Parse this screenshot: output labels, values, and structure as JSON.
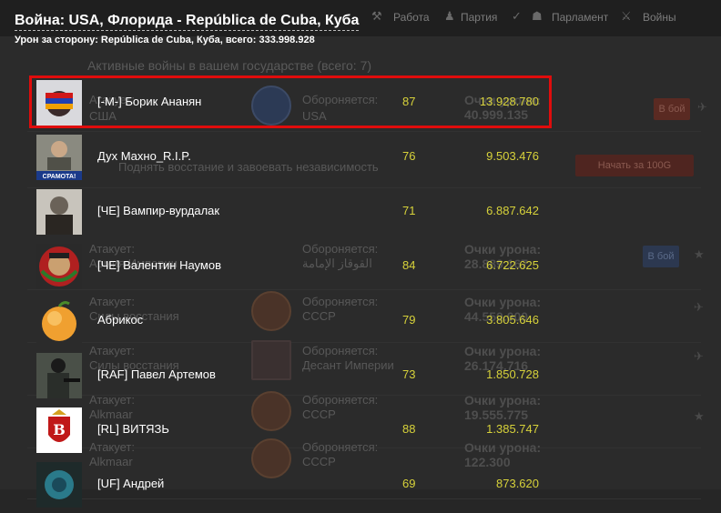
{
  "window": {
    "title": "Война: USA, Флорида - República de Cuba, Куба",
    "damage_label": "Урон за сторону: República de Cuba, Куба, всего:",
    "damage_total": "333.998.928"
  },
  "background": {
    "nav": [
      "Работа",
      "Партия",
      "Парламент",
      "Войны"
    ],
    "heading": "Активные войны в вашем государстве (всего: 7)",
    "attack_label": "Атакует:",
    "defend_label": "Обороняется:",
    "points_label": "Очки урона:",
    "rows": [
      {
        "attacker": "США",
        "defender": "USA",
        "points": "40.999.135",
        "button": "В бой"
      },
      {
        "attacker": "",
        "defender": "",
        "points": "",
        "button": "Начать за 100G",
        "note": "Поднять восстание и завоевать независимость"
      },
      {
        "attacker": "",
        "defender": "",
        "points": "",
        "button": ""
      },
      {
        "attacker": "Армия Империи",
        "defender": "القوقاز الإمامة",
        "points": "28.889.167",
        "button": "В бой"
      },
      {
        "attacker": "Силы восстания",
        "defender": "СССР",
        "points": "44.550.000",
        "button": ""
      },
      {
        "attacker": "Силы восстания",
        "defender": "Десант Империи",
        "points": "26.174.716",
        "button": ""
      },
      {
        "attacker": "Alkmaar",
        "defender": "СССР",
        "points": "19.555.775",
        "button": ""
      },
      {
        "attacker": "Alkmaar",
        "defender": "СССР",
        "points": "122.300",
        "button": ""
      }
    ]
  },
  "players": [
    {
      "name": "[-M-] Борик Ананян",
      "level": "87",
      "damage": "13.928.780",
      "avatar": "flag-avatar-icon"
    },
    {
      "name": "Дух Махно_R.I.P.",
      "level": "76",
      "damage": "9.503.476",
      "avatar": "portrait-avatar-icon",
      "badge": "СРАМОТА!"
    },
    {
      "name": "[ЧЕ] Вампир-вурдалак",
      "level": "71",
      "damage": "6.887.642",
      "avatar": "portrait-avatar-icon"
    },
    {
      "name": "[ЧЕ] Валентин Наумов",
      "level": "84",
      "damage": "6.722.625",
      "avatar": "emblem-avatar-icon"
    },
    {
      "name": "Абрикос",
      "level": "79",
      "damage": "3.805.646",
      "avatar": "apricot-avatar-icon"
    },
    {
      "name": "[RAF] Павел Артемов",
      "level": "73",
      "damage": "1.850.728",
      "avatar": "soldier-avatar-icon"
    },
    {
      "name": "[RL] ВИТЯЗЬ",
      "level": "88",
      "damage": "1.385.747",
      "avatar": "shield-avatar-icon"
    },
    {
      "name": "[UF] Андрей",
      "level": "69",
      "damage": "873.620",
      "avatar": "globe-avatar-icon"
    }
  ],
  "colors": {
    "highlight": "#e00c0c",
    "accent": "#d7d23a",
    "bg": "#262626"
  }
}
